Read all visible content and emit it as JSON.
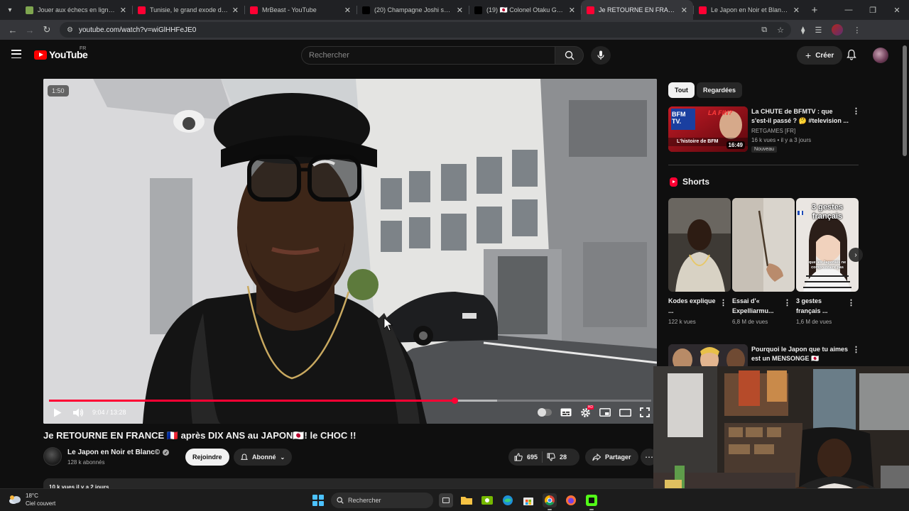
{
  "browser": {
    "tabs": [
      {
        "title": "Jouer aux échecs en ligne contre",
        "fav_color": "#7fa650",
        "active": false
      },
      {
        "title": "Tunisie, le grand exode des mé",
        "fav_color": "#ff0033",
        "active": false
      },
      {
        "title": "MrBeast - YouTube",
        "fav_color": "#ff0033",
        "active": false
      },
      {
        "title": "(20) Champagne Joshi sur X : \"I",
        "fav_color": "#000000",
        "active": false
      },
      {
        "title": "(19) 🇯🇵 Colonel Otaku Gatekeepe",
        "fav_color": "#000000",
        "active": false
      },
      {
        "title": "Je RETOURNE EN FRANCE 🇫🇷 après",
        "fav_color": "#ff0033",
        "active": true
      },
      {
        "title": "Le Japon en Noir et Blanc© - Yo",
        "fav_color": "#ff0033",
        "active": false
      }
    ],
    "url": "youtube.com/watch?v=wiGlHHFeJE0"
  },
  "masthead": {
    "logo_text": "YouTube",
    "region": "FR",
    "search_placeholder": "Rechercher",
    "create_label": "Créer"
  },
  "player": {
    "badge_time": "1:50",
    "current_time": "9:04",
    "duration": "13:28",
    "time_display": "9:04 / 13:28",
    "played_fraction": 0.673,
    "loaded_fraction": 0.744
  },
  "video": {
    "title": "Je RETOURNE EN FRANCE 🇫🇷 après DIX ANS au JAPON🇯🇵! le CHOC !!",
    "channel": "Le Japon en Noir et Blanc©",
    "subscribers": "128 k abonnés",
    "join_label": "Rejoindre",
    "subscribed_label": "Abonné",
    "likes": "695",
    "dislikes": "28",
    "share_label": "Partager",
    "description_preview": "10 k vues  il y a 2 jours"
  },
  "sidebar": {
    "chips": [
      "Tout",
      "Regardées"
    ],
    "rec1": {
      "title": "La CHUTE de BFMTV : que s'est-il passé ? 🤔 #television ...",
      "channel": "RETGAMES [FR]",
      "meta": "16 k vues • il y a 3 jours",
      "badge": "Nouveau",
      "duration": "16:49",
      "thumb_text_top": "LA FIN?",
      "thumb_text_bottom": "L'histoire de BFM",
      "thumb_logo": "BFM TV."
    },
    "shorts_label": "Shorts",
    "shorts": [
      {
        "title": "Kodes explique ...",
        "views": "122 k vues"
      },
      {
        "title": "Essai d'« Expelliarmu...",
        "views": "6,8 M de vues"
      },
      {
        "title": "3 gestes français ...",
        "views": "1,6 M de vues",
        "thumb_text": "3 gestes français",
        "thumb_sub": "que les Japonais ne comprennent pas"
      }
    ],
    "rec2": {
      "title": "Pourquoi le Japon que tu aimes est un MENSONGE 🇯🇵"
    }
  },
  "taskbar": {
    "temperature": "18°C",
    "weather_desc": "Ciel couvert",
    "search_label": "Rechercher"
  },
  "colors": {
    "accent": "#ff0033",
    "background": "#0f0f0f",
    "surface": "#272727"
  }
}
